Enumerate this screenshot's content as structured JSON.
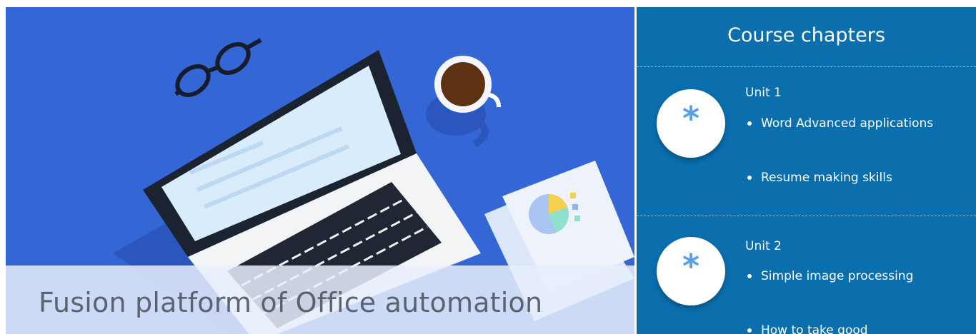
{
  "hero": {
    "title": "Fusion platform of Office automation"
  },
  "panel": {
    "title": "Course chapters",
    "units": [
      {
        "label": "Unit 1",
        "icon_glyph": "*",
        "icon": "asterisk-icon",
        "items": [
          "Word Advanced applications",
          "Resume making skills"
        ]
      },
      {
        "label": "Unit 2",
        "icon_glyph": "*",
        "icon": "asterisk-icon",
        "items": [
          "Simple image processing",
          "How to take good"
        ]
      }
    ]
  },
  "colors": {
    "hero_bg": "#3566d6",
    "panel_bg": "#0b6fae",
    "accent": "#5b9fe6"
  }
}
